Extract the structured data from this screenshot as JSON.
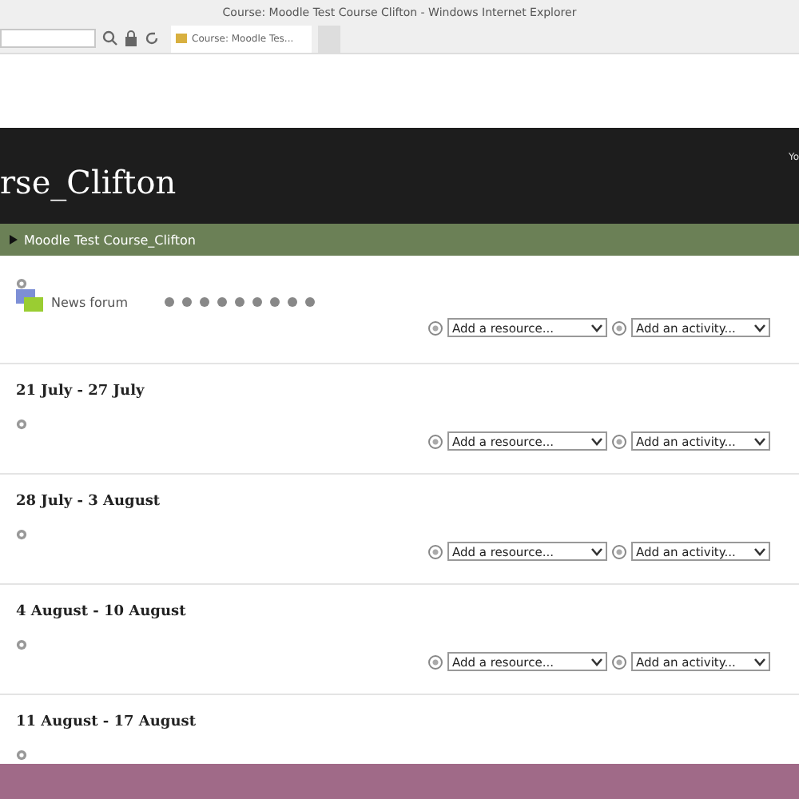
{
  "window": {
    "title": "Course: Moodle Test Course Clifton - Windows Internet Explorer"
  },
  "browser_tab": {
    "label": "Course: Moodle Tes..."
  },
  "header": {
    "title": "rse_Clifton",
    "login_fragment": "Yo"
  },
  "breadcrumb": {
    "current": "Moodle Test Course_Clifton"
  },
  "intro_section": {
    "activity": "News forum",
    "add_resource": "Add a resource...",
    "add_activity": "Add an activity..."
  },
  "sections": [
    {
      "heading": "21 July - 27 July",
      "add_resource": "Add a resource...",
      "add_activity": "Add an activity..."
    },
    {
      "heading": "28 July - 3 August",
      "add_resource": "Add a resource...",
      "add_activity": "Add an activity..."
    },
    {
      "heading": "4 August - 10 August",
      "add_resource": "Add a resource...",
      "add_activity": "Add an activity..."
    },
    {
      "heading": "11 August - 17 August"
    }
  ]
}
